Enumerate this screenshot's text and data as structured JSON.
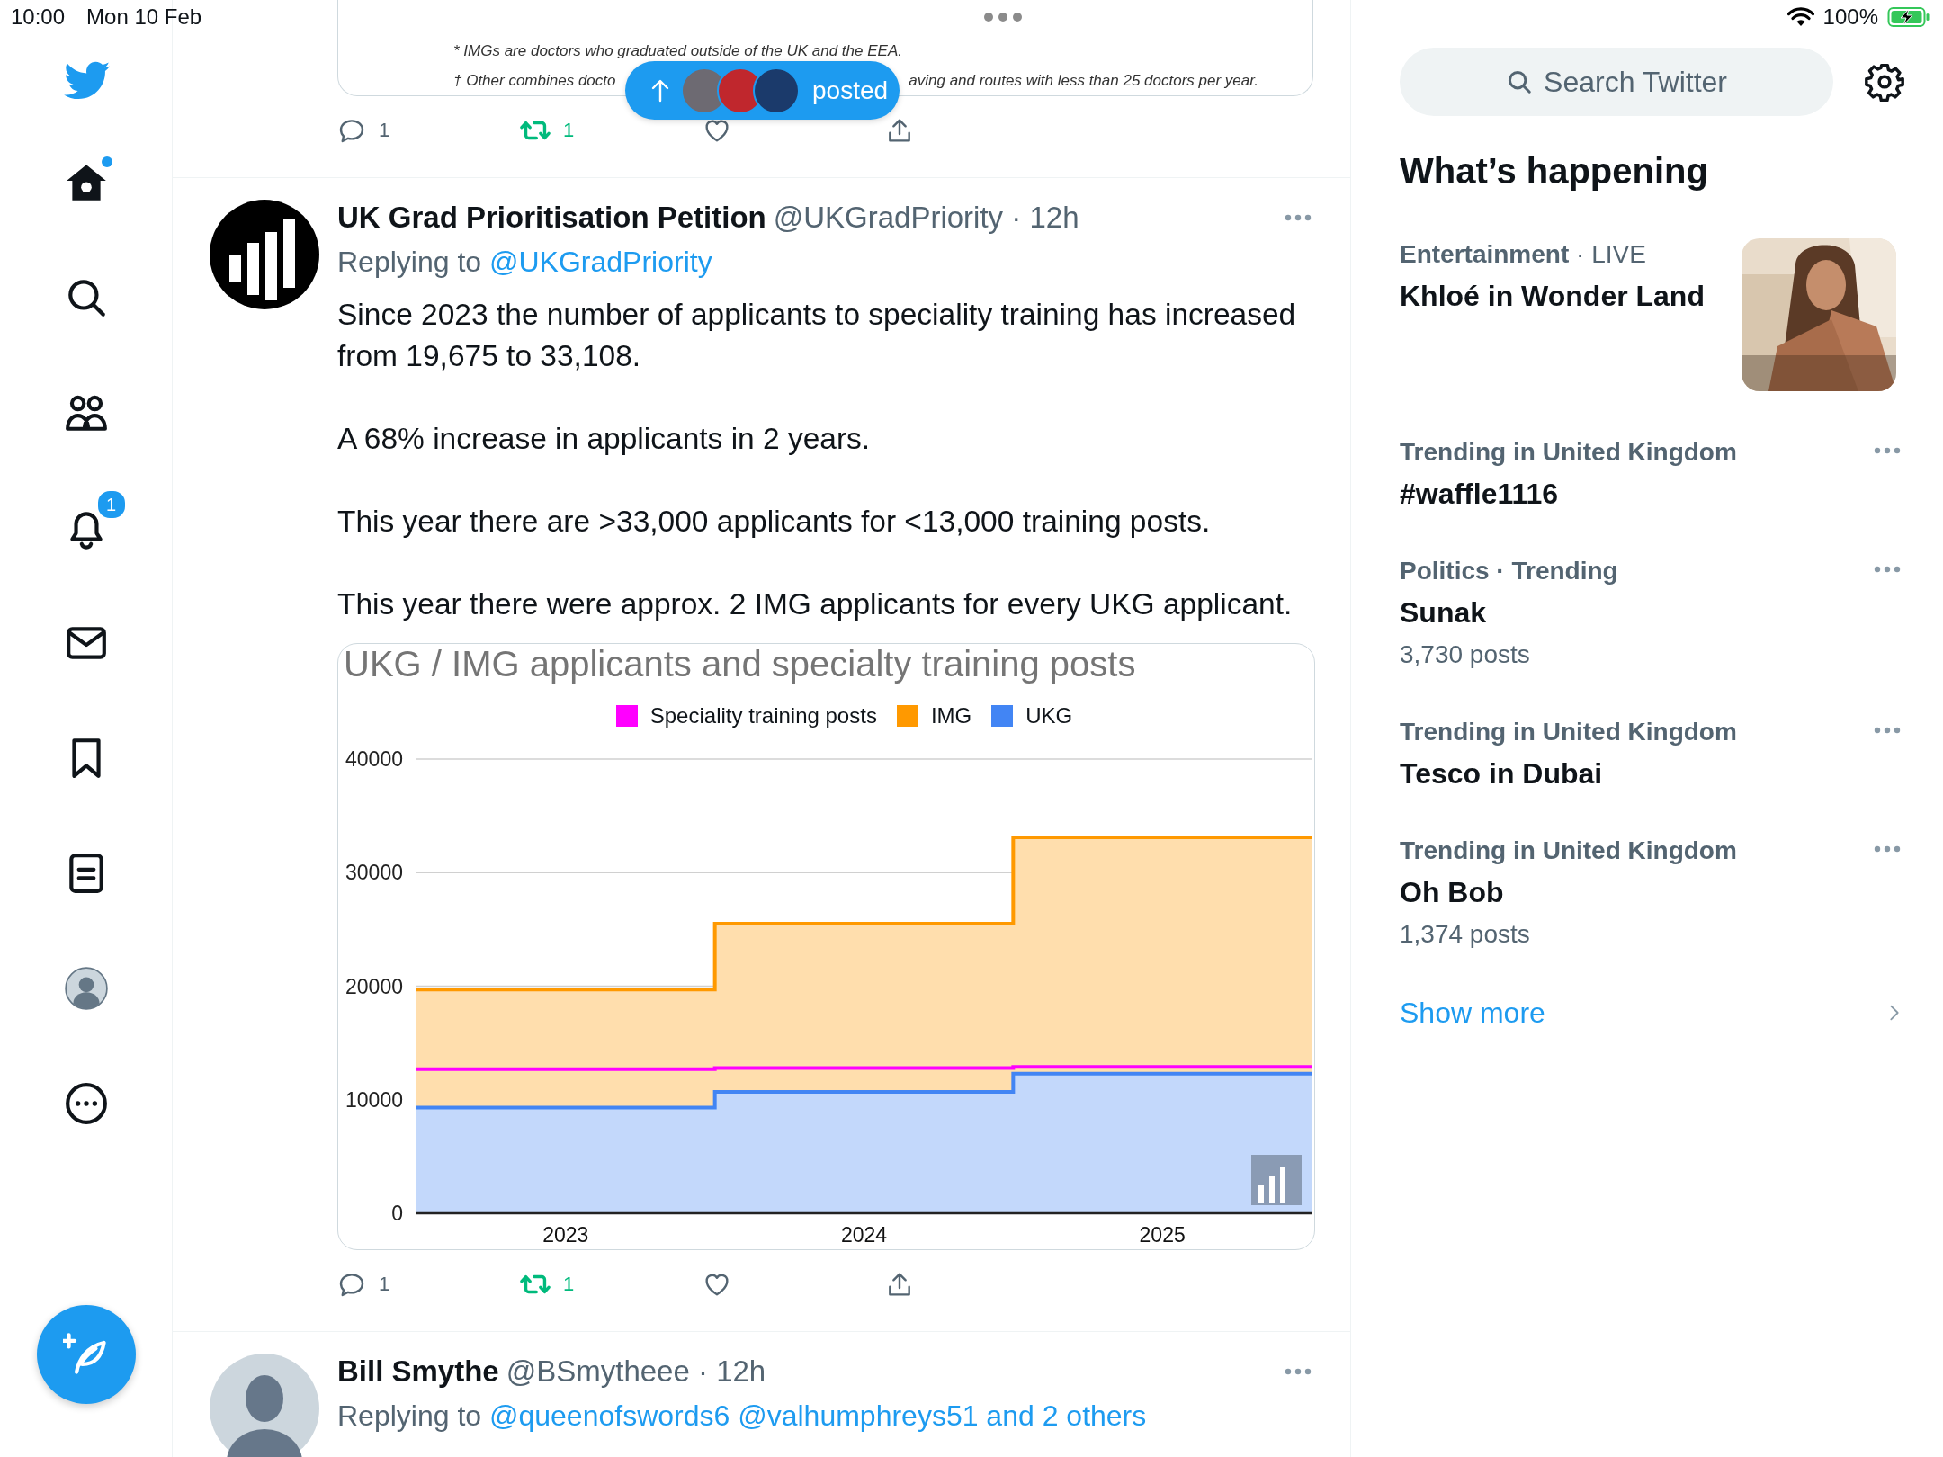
{
  "status_bar": {
    "time": "10:00",
    "date": "Mon 10 Feb",
    "battery": "100%",
    "charging": true
  },
  "sidebar": {
    "items": [
      {
        "kind": "home",
        "selected": true,
        "unread": true
      },
      {
        "kind": "explore",
        "selected": false
      },
      {
        "kind": "communities",
        "selected": false
      },
      {
        "kind": "notifications",
        "selected": false,
        "badge": "1"
      },
      {
        "kind": "messages",
        "selected": false
      },
      {
        "kind": "bookmarks",
        "selected": false
      },
      {
        "kind": "lists",
        "selected": false
      },
      {
        "kind": "profile",
        "selected": false
      },
      {
        "kind": "more",
        "selected": false
      }
    ]
  },
  "new_posts_pill": {
    "label": "posted"
  },
  "top_tweet": {
    "card_lines": [
      [
        "* IMGs are doctors who graduated outside of the UK and the EEA."
      ],
      [
        "† Other combines docto",
        "aving and routes with less than 25 doctors per year."
      ]
    ],
    "actions": {
      "replies": "1",
      "retweets": "1",
      "retweeted": true,
      "liked": false
    }
  },
  "tweets": [
    {
      "author": "UK Grad Prioritisation Petition",
      "handle_time": "@UKGradPriority · 12h",
      "avatar": {
        "kind": "logo"
      },
      "replying_label": "Replying to",
      "mentions": [
        "@UKGradPriority"
      ],
      "paragraphs": [
        "Since 2023 the number of applicants to speciality training has increased from 19,675 to 33,108.",
        "A 68% increase in applicants in 2 years.",
        "This year there are >33,000 applicants for <13,000 training posts.",
        "This year there were approx. 2 IMG applicants for every UKG applicant."
      ],
      "chart_data": {
        "type": "area",
        "title": "UKG / IMG applicants and specialty training posts",
        "x": [
          2022.5,
          2023.5,
          2023.5,
          2024.5,
          2024.5,
          2025.5
        ],
        "series": [
          {
            "name": "Speciality training posts",
            "color": "#ff00ff",
            "values": [
              12700,
              12700,
              12800,
              12800,
              12900,
              12900
            ]
          },
          {
            "name": "IMG",
            "color": "#ff9900",
            "values": [
              19700,
              19700,
              25500,
              25500,
              33100,
              33100
            ]
          },
          {
            "name": "UKG",
            "color": "#4285f4",
            "values": [
              9300,
              9300,
              10700,
              10700,
              12300,
              12300
            ]
          }
        ],
        "xlim": [
          2022.5,
          2025.5
        ],
        "xticks": [
          2023,
          2024,
          2025
        ],
        "ylim": [
          0,
          40000
        ],
        "yticks": [
          0,
          10000,
          20000,
          30000,
          40000
        ],
        "grid": true,
        "legend": "top"
      },
      "actions": {
        "replies": "1",
        "retweets": "1",
        "retweeted": true,
        "liked": false
      }
    },
    {
      "author": "Bill Smythe",
      "handle_time": "@BSmytheee · 12h",
      "avatar": {
        "kind": "default"
      },
      "replying_label": "Replying to",
      "mentions": [
        "@queenofswords6",
        "@valhumphreys51",
        "and 2 others"
      ]
    }
  ],
  "right_panel": {
    "search_placeholder": "Search Twitter",
    "title": "What’s happening",
    "trends": [
      {
        "kind": "picture",
        "category": "Entertainment",
        "category_note": "· LIVE",
        "title": "Khloé in Wonder Land"
      },
      {
        "kind": "menu",
        "category": "Trending in United Kingdom",
        "title": "#waffle1116"
      },
      {
        "kind": "menu",
        "category": "Politics · Trending",
        "title": "Sunak",
        "posts": "3,730 posts"
      },
      {
        "kind": "menu",
        "category": "Trending in United Kingdom",
        "title": "Tesco in Dubai"
      },
      {
        "kind": "menu",
        "category": "Trending in United Kingdom",
        "title": "Oh Bob",
        "posts": "1,374 posts"
      }
    ],
    "show_more": "Show more"
  }
}
